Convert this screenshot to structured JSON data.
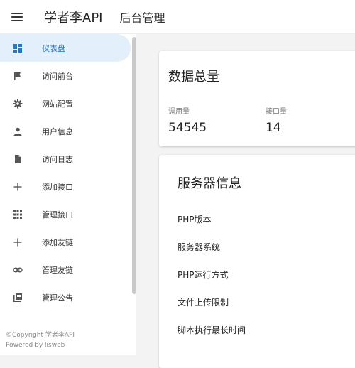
{
  "header": {
    "app_title": "学者李API",
    "app_subtitle": "后台管理"
  },
  "sidebar": {
    "items": [
      {
        "label": "仪表盘",
        "icon": "dashboard-icon",
        "active": true
      },
      {
        "label": "访问前台",
        "icon": "flag-icon"
      },
      {
        "label": "网站配置",
        "icon": "gear-icon"
      },
      {
        "label": "用户信息",
        "icon": "person-icon"
      },
      {
        "label": "访问日志",
        "icon": "document-icon"
      },
      {
        "label": "添加接口",
        "icon": "plus-icon"
      },
      {
        "label": "管理接口",
        "icon": "apps-grid-icon"
      },
      {
        "label": "添加友链",
        "icon": "plus-icon"
      },
      {
        "label": "管理友链",
        "icon": "link-icon"
      },
      {
        "label": "管理公告",
        "icon": "library-icon"
      }
    ],
    "active_color": "#1f78c8",
    "active_bg": "#e3f0fb"
  },
  "footer": {
    "copyright": "©Copyright 学者李API",
    "powered": "Powered by lisweb"
  },
  "stats_card": {
    "title": "数据总量",
    "stats": [
      {
        "label": "调用量",
        "value": "54545"
      },
      {
        "label": "接口量",
        "value": "14"
      }
    ]
  },
  "server_card": {
    "title": "服务器信息",
    "items": [
      "PHP版本",
      "服务器系统",
      "PHP运行方式",
      "文件上传限制",
      "脚本执行最长时间"
    ]
  }
}
